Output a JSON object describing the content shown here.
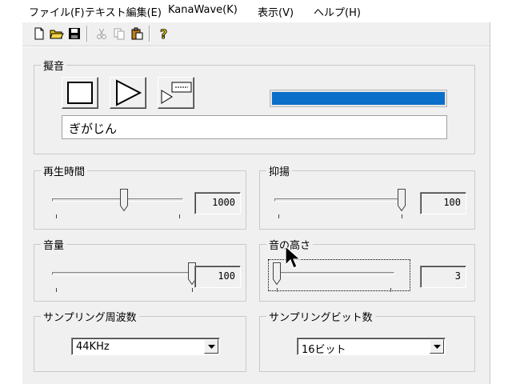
{
  "menu": {
    "file": "ファイル(F)",
    "text_edit": "テキスト編集(E)",
    "kanawave": "KanaWave(K)",
    "view": "表示(V)",
    "help": "ヘルプ(H)"
  },
  "toolbar": {
    "icons": [
      "new-file-icon",
      "open-folder-icon",
      "save-icon",
      "cut-icon",
      "copy-icon",
      "paste-icon",
      "help-icon"
    ]
  },
  "onomatopoeia": {
    "group_label": "擬音",
    "text_value": "ぎがじん",
    "progress_fraction": 1.0,
    "progress_color": "#0a6fc9"
  },
  "playback_time": {
    "group_label": "再生時間",
    "value": "1000",
    "slider_fraction": 0.55
  },
  "intonation": {
    "group_label": "抑揚",
    "value": "100",
    "slider_fraction": 1.0
  },
  "volume": {
    "group_label": "音量",
    "value": "100",
    "slider_fraction": 1.0
  },
  "pitch": {
    "group_label": "音の高さ",
    "value": "3",
    "slider_fraction": 0.0
  },
  "sampling_rate": {
    "group_label": "サンプリング周波数",
    "selected": "44KHz"
  },
  "sampling_bits": {
    "group_label": "サンプリングビット数",
    "selected": "16ビット"
  }
}
